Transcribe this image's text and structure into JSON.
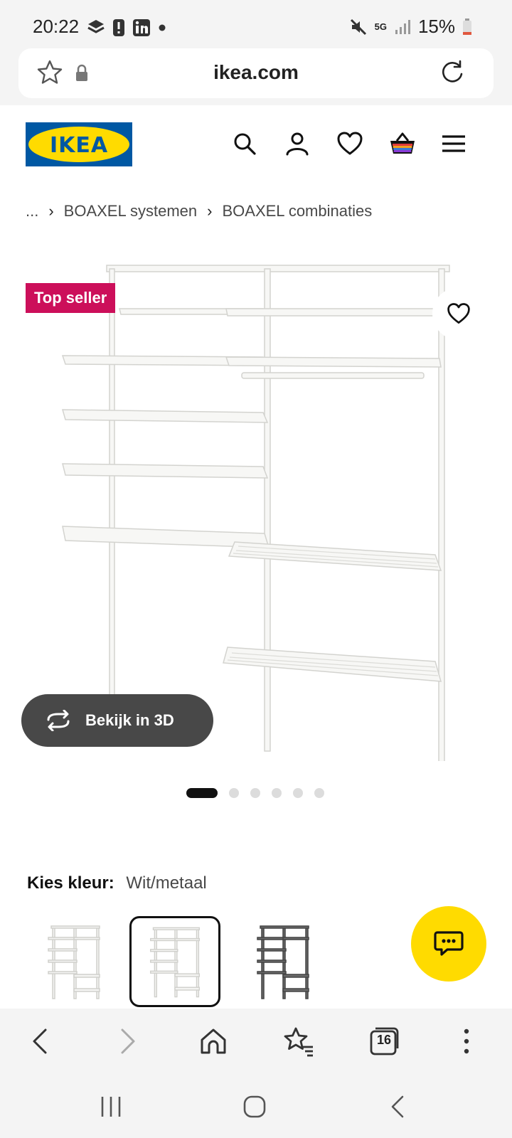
{
  "status_bar": {
    "time": "20:22",
    "network": "5G",
    "battery": "15%",
    "left_icons": [
      "stack-notification-icon",
      "alert-icon",
      "linkedin-icon",
      "dot-icon"
    ],
    "right_icons": [
      "mute-icon",
      "signal-icon",
      "battery-icon"
    ]
  },
  "browser": {
    "url": "ikea.com"
  },
  "header": {
    "logo_text": "IKEA",
    "icons": [
      "search-icon",
      "account-icon",
      "favourites-icon",
      "basket-icon",
      "menu-icon"
    ]
  },
  "breadcrumb": {
    "ellipsis": "...",
    "items": [
      "BOAXEL systemen",
      "BOAXEL combinaties"
    ],
    "separator": "›"
  },
  "product": {
    "badge": "Top seller",
    "view_3d_label": "Bekijk in 3D",
    "image_count": 6,
    "active_image_index": 0
  },
  "colour": {
    "label": "Kies kleur:",
    "value": "Wit/metaal",
    "swatch_count": 3,
    "selected_index": 1
  },
  "tabs_count": "16",
  "colors": {
    "ikea_blue": "#0058a3",
    "ikea_yellow": "#ffdb00",
    "badge_red": "#cc0f5a",
    "dark_button": "#484848"
  }
}
